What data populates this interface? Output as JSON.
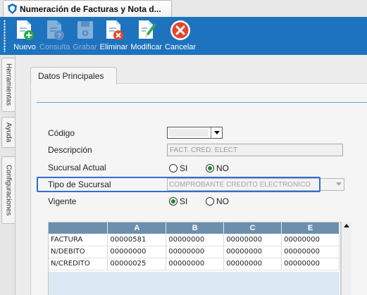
{
  "window": {
    "tab_title": "Numeración de Facturas y Nota d..."
  },
  "toolbar": {
    "buttons": [
      {
        "label": "Nuevo",
        "icon": "new-document-icon",
        "enabled": true
      },
      {
        "label": "Consulta",
        "icon": "query-document-icon",
        "enabled": false
      },
      {
        "label": "Grabar",
        "icon": "save-disk-icon",
        "enabled": false
      },
      {
        "label": "Eliminar",
        "icon": "delete-document-icon",
        "enabled": true
      },
      {
        "label": "Modificar",
        "icon": "edit-document-icon",
        "enabled": true
      },
      {
        "label": "Cancelar",
        "icon": "cancel-icon",
        "enabled": true
      }
    ]
  },
  "sidebar": {
    "tabs": [
      {
        "label": "Herramientas"
      },
      {
        "label": "Ayuda"
      },
      {
        "label": "Configuraciones"
      }
    ]
  },
  "panel": {
    "tab_label": "Datos Principales"
  },
  "form": {
    "codigo_label": "Código",
    "descripcion_label": "Descripción",
    "descripcion_value": "FACT. CRED. ELECT",
    "sucursal_actual_label": "Sucursal Actual",
    "sucursal_actual_options": [
      "SI",
      "NO"
    ],
    "sucursal_actual_selected": "NO",
    "tipo_sucursal_label": "Tipo de Sucursal",
    "tipo_sucursal_value": "COMPROBANTE CREDITO ELECTRONICO",
    "vigente_label": "Vigente",
    "vigente_options": [
      "SI",
      "NO"
    ],
    "vigente_selected": "SI"
  },
  "grid": {
    "columns": [
      "",
      "A",
      "B",
      "C",
      "E"
    ],
    "rows": [
      [
        "FACTURA",
        "00000581",
        "00000000",
        "00000000",
        "00000000"
      ],
      [
        "N/DEBITO",
        "00000000",
        "00000000",
        "00000000",
        "00000000"
      ],
      [
        "N/CREDITO",
        "00000025",
        "00000000",
        "00000000",
        "00000000"
      ]
    ]
  },
  "colors": {
    "toolbar": "#1e73be",
    "accent_green": "#1b8a2f",
    "highlight": "#2f6fd1",
    "grid_header": "#6c8fae"
  }
}
